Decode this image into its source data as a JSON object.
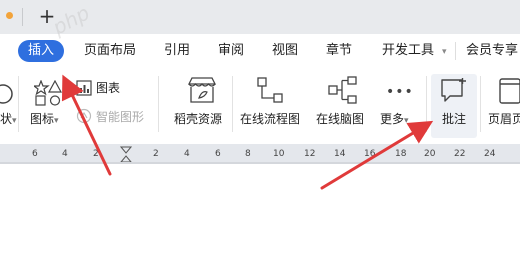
{
  "tabbar": {
    "new_tab_glyph": "+",
    "accent": "#f2a33a"
  },
  "menu": {
    "items": [
      "插入",
      "页面布局",
      "引用",
      "审阅",
      "视图",
      "章节",
      "开发工具",
      "会员专享"
    ],
    "active": "插入",
    "active_color": "#2f6fdf"
  },
  "ribbon": {
    "shape_suffix": "状",
    "shape_caret": "▾",
    "icon_label": "图标",
    "icon_caret": "▾",
    "chart_label": "图表",
    "smart_label": "智能图形",
    "daoke_label": "稻壳资源",
    "flowchart_label": "在线流程图",
    "mindmap_label": "在线脑图",
    "more_label": "更多",
    "more_caret": "▾",
    "comment_label": "批注",
    "header_label": "页眉页"
  },
  "ruler": {
    "ticks": [
      "6",
      "4",
      "2",
      "2",
      "4",
      "6",
      "8",
      "10",
      "12",
      "14",
      "16",
      "18",
      "20",
      "22",
      "24"
    ]
  },
  "watermark": "php",
  "annotation_color": "#e03a3a"
}
